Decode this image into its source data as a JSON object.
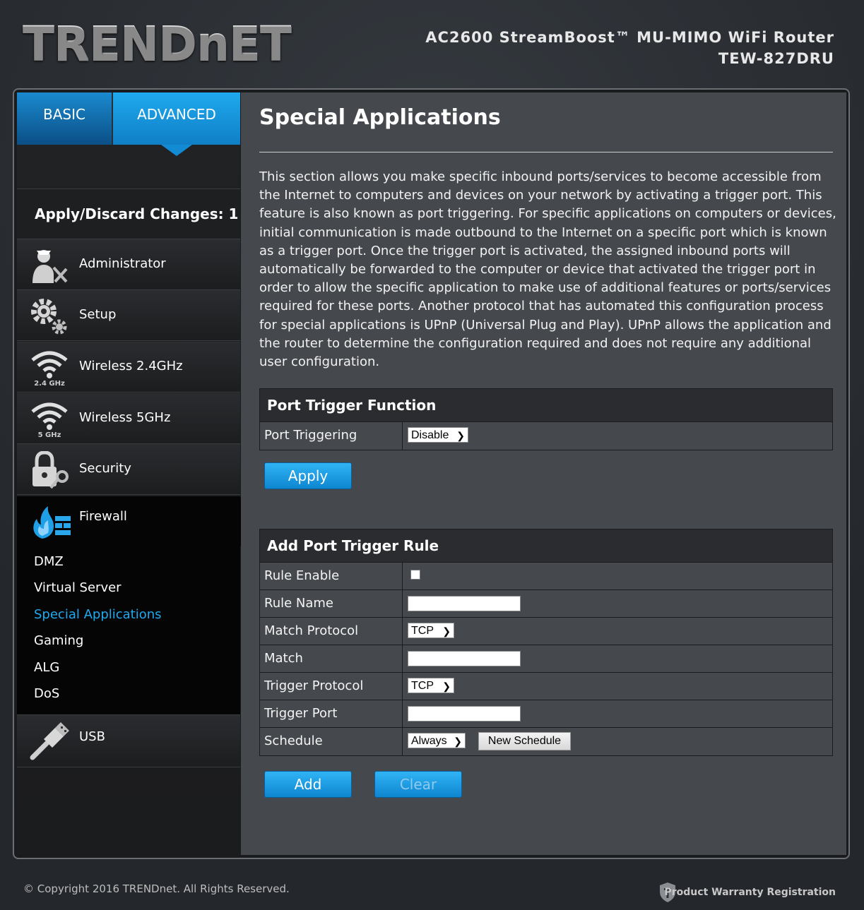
{
  "brand": {
    "logo": "TRENDnET"
  },
  "header": {
    "model_line1": "AC2600 StreamBoost™ MU-MIMO WiFi Router",
    "model_line2": "TEW-827DRU"
  },
  "tabs": {
    "basic": "BASIC",
    "advanced": "ADVANCED"
  },
  "sidebar": {
    "apply_discard": "Apply/Discard Changes: 1",
    "items": [
      {
        "label": "Administrator",
        "icon": "administrator-icon"
      },
      {
        "label": "Setup",
        "icon": "gear-icon"
      },
      {
        "label": "Wireless 2.4GHz",
        "icon": "wifi-icon",
        "badge": "2.4 GHz"
      },
      {
        "label": "Wireless 5GHz",
        "icon": "wifi-icon",
        "badge": "5 GHz"
      },
      {
        "label": "Security",
        "icon": "lock-key-icon"
      },
      {
        "label": "Firewall",
        "icon": "firewall-icon"
      },
      {
        "label": "USB",
        "icon": "usb-icon"
      }
    ],
    "firewall_sub": [
      "DMZ",
      "Virtual Server",
      "Special Applications",
      "Gaming",
      "ALG",
      "DoS"
    ]
  },
  "page": {
    "title": "Special Applications",
    "description": "This section allows you make specific inbound ports/services to become accessible from the Internet to computers and devices on your network by activating a trigger port. This feature is also known as port triggering. For specific applications on computers or devices, initial communication is made outbound to the Internet on a specific port which is known as a trigger port. Once the trigger port is activated, the assigned inbound ports will automatically be forwarded to the computer or device that activated the trigger port in order to allow the specific application to make use of additional features or ports/services required for these ports. Another protocol that has automated this configuration process for special applications is UPnP (Universal Plug and Play). UPnP allows the application and the router to determine the configuration required and does not require any additional user configuration."
  },
  "port_trigger_function": {
    "title": "Port Trigger Function",
    "port_triggering_label": "Port Triggering",
    "port_triggering_value": "Disable",
    "apply": "Apply"
  },
  "add_rule": {
    "title": "Add Port Trigger Rule",
    "rule_enable": "Rule Enable",
    "rule_name": "Rule Name",
    "match_protocol": "Match Protocol",
    "match_protocol_value": "TCP",
    "match": "Match",
    "trigger_protocol": "Trigger Protocol",
    "trigger_protocol_value": "TCP",
    "trigger_port": "Trigger Port",
    "schedule": "Schedule",
    "schedule_value": "Always",
    "new_schedule": "New Schedule",
    "add": "Add",
    "clear": "Clear"
  },
  "footer": {
    "copyright": "© Copyright 2016 TRENDnet. All Rights Reserved.",
    "warranty": "Product Warranty Registration"
  },
  "colors": {
    "accent_blue": "#1eaaf1",
    "tab_blue": "#138bd4"
  }
}
